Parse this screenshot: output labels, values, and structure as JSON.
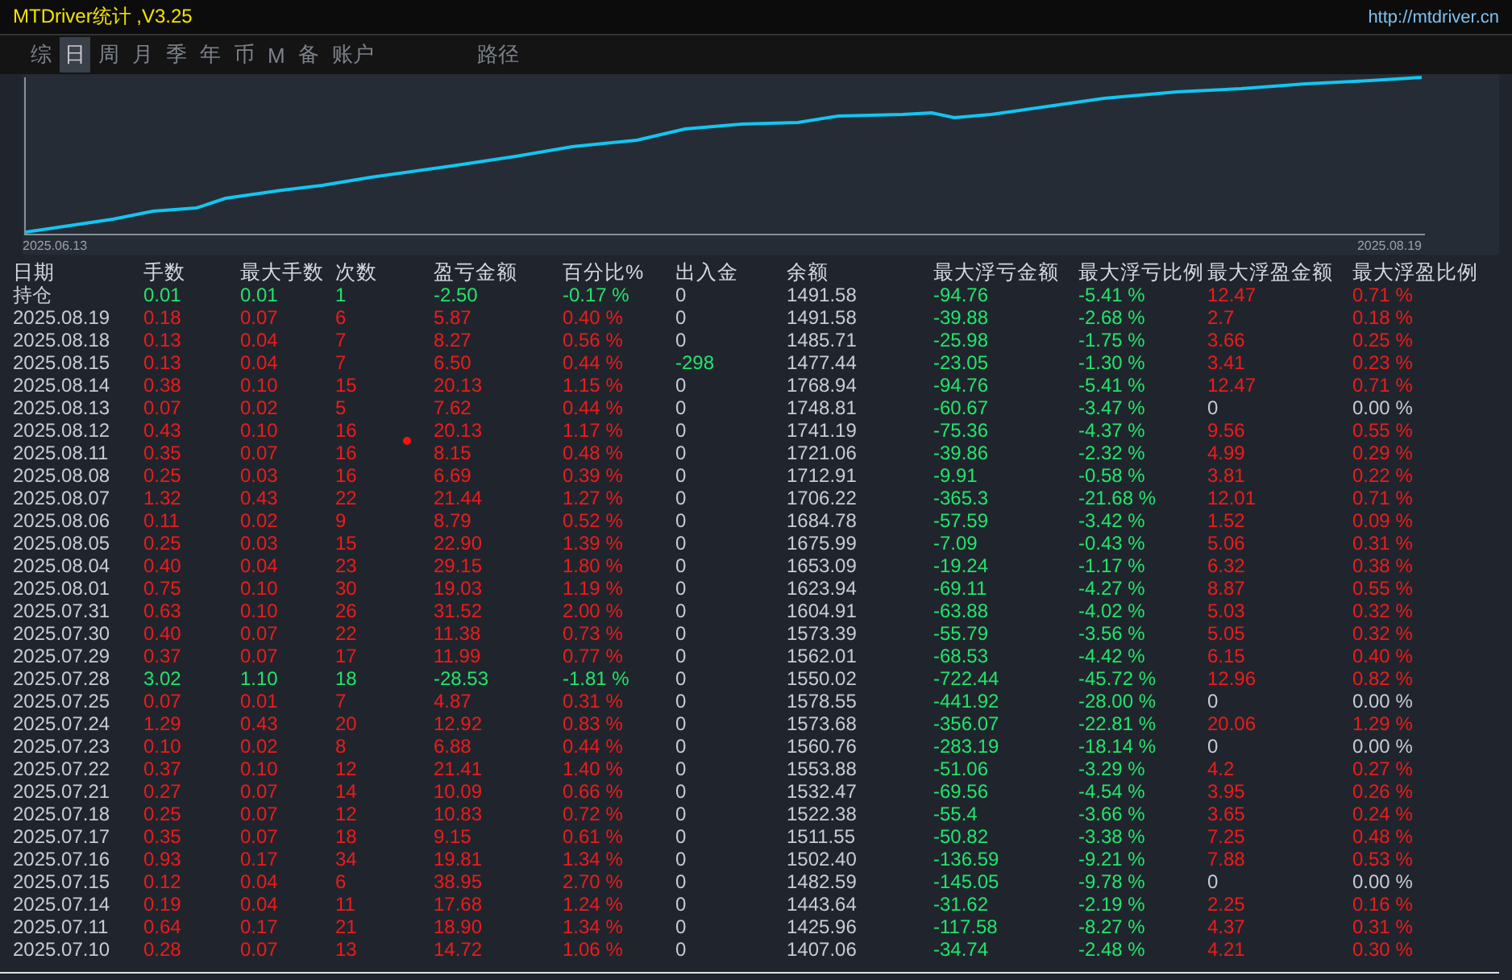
{
  "window": {
    "title": "MTDriver统计 ,V3.25",
    "url": "http://mtdriver.cn"
  },
  "tabs": [
    {
      "label": "综",
      "selected": false
    },
    {
      "label": "日",
      "selected": true
    },
    {
      "label": "周",
      "selected": false
    },
    {
      "label": "月",
      "selected": false
    },
    {
      "label": "季",
      "selected": false
    },
    {
      "label": "年",
      "selected": false
    },
    {
      "label": "币",
      "selected": false
    },
    {
      "label": "M",
      "selected": false
    },
    {
      "label": "备",
      "selected": false
    },
    {
      "label": "账户",
      "selected": false
    },
    {
      "label": "路径",
      "selected": false
    }
  ],
  "chart": {
    "start_label": "2025.06.13",
    "end_label": "2025.08.19"
  },
  "table": {
    "columns": [
      "日期",
      "手数",
      "最大手数",
      "次数",
      "盈亏金额",
      "百分比%",
      "出入金",
      "余额",
      "最大浮亏金额",
      "最大浮亏比例",
      "最大浮盈金额",
      "最大浮盈比例"
    ],
    "rows": [
      {
        "date": "持仓",
        "lots": "0.01",
        "max_lots": "0.01",
        "trades": "1",
        "pnl": "-2.50",
        "pct": "-0.17 %",
        "deposit": "0",
        "balance": "1491.58",
        "max_loss": "-94.76",
        "max_loss_pct": "-5.41 %",
        "max_gain": "12.47",
        "max_gain_pct": "0.71 %",
        "loss": true,
        "withdrawal": false,
        "float_gain": true
      },
      {
        "date": "2025.08.19",
        "lots": "0.18",
        "max_lots": "0.07",
        "trades": "6",
        "pnl": "5.87",
        "pct": "0.40 %",
        "deposit": "0",
        "balance": "1491.58",
        "max_loss": "-39.88",
        "max_loss_pct": "-2.68 %",
        "max_gain": "2.7",
        "max_gain_pct": "0.18 %",
        "loss": false,
        "withdrawal": false,
        "float_gain": true
      },
      {
        "date": "2025.08.18",
        "lots": "0.13",
        "max_lots": "0.04",
        "trades": "7",
        "pnl": "8.27",
        "pct": "0.56 %",
        "deposit": "0",
        "balance": "1485.71",
        "max_loss": "-25.98",
        "max_loss_pct": "-1.75 %",
        "max_gain": "3.66",
        "max_gain_pct": "0.25 %",
        "loss": false,
        "withdrawal": false,
        "float_gain": true
      },
      {
        "date": "2025.08.15",
        "lots": "0.13",
        "max_lots": "0.04",
        "trades": "7",
        "pnl": "6.50",
        "pct": "0.44 %",
        "deposit": "-298",
        "balance": "1477.44",
        "max_loss": "-23.05",
        "max_loss_pct": "-1.30 %",
        "max_gain": "3.41",
        "max_gain_pct": "0.23 %",
        "loss": false,
        "withdrawal": true,
        "float_gain": true
      },
      {
        "date": "2025.08.14",
        "lots": "0.38",
        "max_lots": "0.10",
        "trades": "15",
        "pnl": "20.13",
        "pct": "1.15 %",
        "deposit": "0",
        "balance": "1768.94",
        "max_loss": "-94.76",
        "max_loss_pct": "-5.41 %",
        "max_gain": "12.47",
        "max_gain_pct": "0.71 %",
        "loss": false,
        "withdrawal": false,
        "float_gain": true
      },
      {
        "date": "2025.08.13",
        "lots": "0.07",
        "max_lots": "0.02",
        "trades": "5",
        "pnl": "7.62",
        "pct": "0.44 %",
        "deposit": "0",
        "balance": "1748.81",
        "max_loss": "-60.67",
        "max_loss_pct": "-3.47 %",
        "max_gain": "0",
        "max_gain_pct": "0.00 %",
        "loss": false,
        "withdrawal": false,
        "float_gain": false
      },
      {
        "date": "2025.08.12",
        "lots": "0.43",
        "max_lots": "0.10",
        "trades": "16",
        "pnl": "20.13",
        "pct": "1.17 %",
        "deposit": "0",
        "balance": "1741.19",
        "max_loss": "-75.36",
        "max_loss_pct": "-4.37 %",
        "max_gain": "9.56",
        "max_gain_pct": "0.55 %",
        "loss": false,
        "withdrawal": false,
        "float_gain": true
      },
      {
        "date": "2025.08.11",
        "lots": "0.35",
        "max_lots": "0.07",
        "trades": "16",
        "pnl": "8.15",
        "pct": "0.48 %",
        "deposit": "0",
        "balance": "1721.06",
        "max_loss": "-39.86",
        "max_loss_pct": "-2.32 %",
        "max_gain": "4.99",
        "max_gain_pct": "0.29 %",
        "loss": false,
        "withdrawal": false,
        "float_gain": true
      },
      {
        "date": "2025.08.08",
        "lots": "0.25",
        "max_lots": "0.03",
        "trades": "16",
        "pnl": "6.69",
        "pct": "0.39 %",
        "deposit": "0",
        "balance": "1712.91",
        "max_loss": "-9.91",
        "max_loss_pct": "-0.58 %",
        "max_gain": "3.81",
        "max_gain_pct": "0.22 %",
        "loss": false,
        "withdrawal": false,
        "float_gain": true
      },
      {
        "date": "2025.08.07",
        "lots": "1.32",
        "max_lots": "0.43",
        "trades": "22",
        "pnl": "21.44",
        "pct": "1.27 %",
        "deposit": "0",
        "balance": "1706.22",
        "max_loss": "-365.3",
        "max_loss_pct": "-21.68 %",
        "max_gain": "12.01",
        "max_gain_pct": "0.71 %",
        "loss": false,
        "withdrawal": false,
        "float_gain": true
      },
      {
        "date": "2025.08.06",
        "lots": "0.11",
        "max_lots": "0.02",
        "trades": "9",
        "pnl": "8.79",
        "pct": "0.52 %",
        "deposit": "0",
        "balance": "1684.78",
        "max_loss": "-57.59",
        "max_loss_pct": "-3.42 %",
        "max_gain": "1.52",
        "max_gain_pct": "0.09 %",
        "loss": false,
        "withdrawal": false,
        "float_gain": true
      },
      {
        "date": "2025.08.05",
        "lots": "0.25",
        "max_lots": "0.03",
        "trades": "15",
        "pnl": "22.90",
        "pct": "1.39 %",
        "deposit": "0",
        "balance": "1675.99",
        "max_loss": "-7.09",
        "max_loss_pct": "-0.43 %",
        "max_gain": "5.06",
        "max_gain_pct": "0.31 %",
        "loss": false,
        "withdrawal": false,
        "float_gain": true
      },
      {
        "date": "2025.08.04",
        "lots": "0.40",
        "max_lots": "0.04",
        "trades": "23",
        "pnl": "29.15",
        "pct": "1.80 %",
        "deposit": "0",
        "balance": "1653.09",
        "max_loss": "-19.24",
        "max_loss_pct": "-1.17 %",
        "max_gain": "6.32",
        "max_gain_pct": "0.38 %",
        "loss": false,
        "withdrawal": false,
        "float_gain": true
      },
      {
        "date": "2025.08.01",
        "lots": "0.75",
        "max_lots": "0.10",
        "trades": "30",
        "pnl": "19.03",
        "pct": "1.19 %",
        "deposit": "0",
        "balance": "1623.94",
        "max_loss": "-69.11",
        "max_loss_pct": "-4.27 %",
        "max_gain": "8.87",
        "max_gain_pct": "0.55 %",
        "loss": false,
        "withdrawal": false,
        "float_gain": true
      },
      {
        "date": "2025.07.31",
        "lots": "0.63",
        "max_lots": "0.10",
        "trades": "26",
        "pnl": "31.52",
        "pct": "2.00 %",
        "deposit": "0",
        "balance": "1604.91",
        "max_loss": "-63.88",
        "max_loss_pct": "-4.02 %",
        "max_gain": "5.03",
        "max_gain_pct": "0.32 %",
        "loss": false,
        "withdrawal": false,
        "float_gain": true
      },
      {
        "date": "2025.07.30",
        "lots": "0.40",
        "max_lots": "0.07",
        "trades": "22",
        "pnl": "11.38",
        "pct": "0.73 %",
        "deposit": "0",
        "balance": "1573.39",
        "max_loss": "-55.79",
        "max_loss_pct": "-3.56 %",
        "max_gain": "5.05",
        "max_gain_pct": "0.32 %",
        "loss": false,
        "withdrawal": false,
        "float_gain": true
      },
      {
        "date": "2025.07.29",
        "lots": "0.37",
        "max_lots": "0.07",
        "trades": "17",
        "pnl": "11.99",
        "pct": "0.77 %",
        "deposit": "0",
        "balance": "1562.01",
        "max_loss": "-68.53",
        "max_loss_pct": "-4.42 %",
        "max_gain": "6.15",
        "max_gain_pct": "0.40 %",
        "loss": false,
        "withdrawal": false,
        "float_gain": true
      },
      {
        "date": "2025.07.28",
        "lots": "3.02",
        "max_lots": "1.10",
        "trades": "18",
        "pnl": "-28.53",
        "pct": "-1.81 %",
        "deposit": "0",
        "balance": "1550.02",
        "max_loss": "-722.44",
        "max_loss_pct": "-45.72 %",
        "max_gain": "12.96",
        "max_gain_pct": "0.82 %",
        "loss": true,
        "withdrawal": false,
        "float_gain": true
      },
      {
        "date": "2025.07.25",
        "lots": "0.07",
        "max_lots": "0.01",
        "trades": "7",
        "pnl": "4.87",
        "pct": "0.31 %",
        "deposit": "0",
        "balance": "1578.55",
        "max_loss": "-441.92",
        "max_loss_pct": "-28.00 %",
        "max_gain": "0",
        "max_gain_pct": "0.00 %",
        "loss": false,
        "withdrawal": false,
        "float_gain": false
      },
      {
        "date": "2025.07.24",
        "lots": "1.29",
        "max_lots": "0.43",
        "trades": "20",
        "pnl": "12.92",
        "pct": "0.83 %",
        "deposit": "0",
        "balance": "1573.68",
        "max_loss": "-356.07",
        "max_loss_pct": "-22.81 %",
        "max_gain": "20.06",
        "max_gain_pct": "1.29 %",
        "loss": false,
        "withdrawal": false,
        "float_gain": true
      },
      {
        "date": "2025.07.23",
        "lots": "0.10",
        "max_lots": "0.02",
        "trades": "8",
        "pnl": "6.88",
        "pct": "0.44 %",
        "deposit": "0",
        "balance": "1560.76",
        "max_loss": "-283.19",
        "max_loss_pct": "-18.14 %",
        "max_gain": "0",
        "max_gain_pct": "0.00 %",
        "loss": false,
        "withdrawal": false,
        "float_gain": false
      },
      {
        "date": "2025.07.22",
        "lots": "0.37",
        "max_lots": "0.10",
        "trades": "12",
        "pnl": "21.41",
        "pct": "1.40 %",
        "deposit": "0",
        "balance": "1553.88",
        "max_loss": "-51.06",
        "max_loss_pct": "-3.29 %",
        "max_gain": "4.2",
        "max_gain_pct": "0.27 %",
        "loss": false,
        "withdrawal": false,
        "float_gain": true
      },
      {
        "date": "2025.07.21",
        "lots": "0.27",
        "max_lots": "0.07",
        "trades": "14",
        "pnl": "10.09",
        "pct": "0.66 %",
        "deposit": "0",
        "balance": "1532.47",
        "max_loss": "-69.56",
        "max_loss_pct": "-4.54 %",
        "max_gain": "3.95",
        "max_gain_pct": "0.26 %",
        "loss": false,
        "withdrawal": false,
        "float_gain": true
      },
      {
        "date": "2025.07.18",
        "lots": "0.25",
        "max_lots": "0.07",
        "trades": "12",
        "pnl": "10.83",
        "pct": "0.72 %",
        "deposit": "0",
        "balance": "1522.38",
        "max_loss": "-55.4",
        "max_loss_pct": "-3.66 %",
        "max_gain": "3.65",
        "max_gain_pct": "0.24 %",
        "loss": false,
        "withdrawal": false,
        "float_gain": true
      },
      {
        "date": "2025.07.17",
        "lots": "0.35",
        "max_lots": "0.07",
        "trades": "18",
        "pnl": "9.15",
        "pct": "0.61 %",
        "deposit": "0",
        "balance": "1511.55",
        "max_loss": "-50.82",
        "max_loss_pct": "-3.38 %",
        "max_gain": "7.25",
        "max_gain_pct": "0.48 %",
        "loss": false,
        "withdrawal": false,
        "float_gain": true
      },
      {
        "date": "2025.07.16",
        "lots": "0.93",
        "max_lots": "0.17",
        "trades": "34",
        "pnl": "19.81",
        "pct": "1.34 %",
        "deposit": "0",
        "balance": "1502.40",
        "max_loss": "-136.59",
        "max_loss_pct": "-9.21 %",
        "max_gain": "7.88",
        "max_gain_pct": "0.53 %",
        "loss": false,
        "withdrawal": false,
        "float_gain": true
      },
      {
        "date": "2025.07.15",
        "lots": "0.12",
        "max_lots": "0.04",
        "trades": "6",
        "pnl": "38.95",
        "pct": "2.70 %",
        "deposit": "0",
        "balance": "1482.59",
        "max_loss": "-145.05",
        "max_loss_pct": "-9.78 %",
        "max_gain": "0",
        "max_gain_pct": "0.00 %",
        "loss": false,
        "withdrawal": false,
        "float_gain": false
      },
      {
        "date": "2025.07.14",
        "lots": "0.19",
        "max_lots": "0.04",
        "trades": "11",
        "pnl": "17.68",
        "pct": "1.24 %",
        "deposit": "0",
        "balance": "1443.64",
        "max_loss": "-31.62",
        "max_loss_pct": "-2.19 %",
        "max_gain": "2.25",
        "max_gain_pct": "0.16 %",
        "loss": false,
        "withdrawal": false,
        "float_gain": true
      },
      {
        "date": "2025.07.11",
        "lots": "0.64",
        "max_lots": "0.17",
        "trades": "21",
        "pnl": "18.90",
        "pct": "1.34 %",
        "deposit": "0",
        "balance": "1425.96",
        "max_loss": "-117.58",
        "max_loss_pct": "-8.27 %",
        "max_gain": "4.37",
        "max_gain_pct": "0.31 %",
        "loss": false,
        "withdrawal": false,
        "float_gain": true
      },
      {
        "date": "2025.07.10",
        "lots": "0.28",
        "max_lots": "0.07",
        "trades": "13",
        "pnl": "14.72",
        "pct": "1.06 %",
        "deposit": "0",
        "balance": "1407.06",
        "max_loss": "-34.74",
        "max_loss_pct": "-2.48 %",
        "max_gain": "4.21",
        "max_gain_pct": "0.30 %",
        "loss": false,
        "withdrawal": false,
        "float_gain": true
      }
    ]
  }
}
